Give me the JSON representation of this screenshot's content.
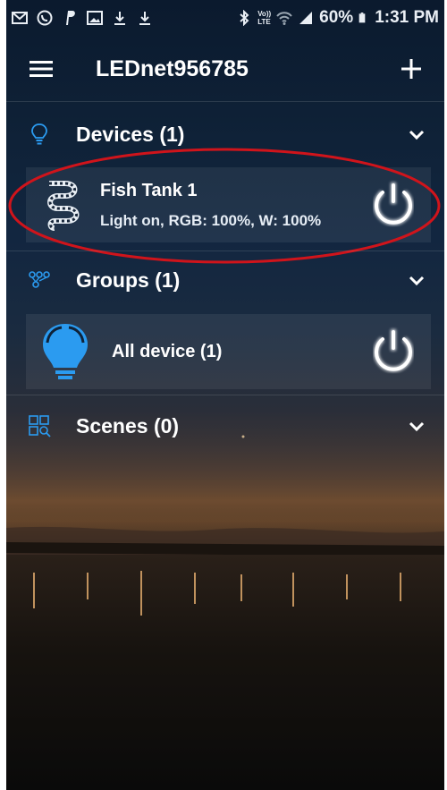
{
  "status_bar": {
    "battery": "60%",
    "time": "1:31 PM",
    "left_icons": [
      "mail-icon",
      "whatsapp-icon",
      "paypal-icon",
      "gallery-icon",
      "download-icon",
      "download-icon"
    ],
    "right_icons": [
      "bluetooth-icon",
      "volte-icon",
      "wifi-icon",
      "signal-icon",
      "battery-icon"
    ],
    "network_badge_top": "Vo))",
    "network_badge_bottom": "LTE"
  },
  "toolbar": {
    "title": "LEDnet956785",
    "menu_icon": "hamburger-menu-icon",
    "add_icon": "plus-icon"
  },
  "sections": {
    "devices": {
      "title": "Devices (1)",
      "icon": "lightbulb-outline-icon",
      "items": [
        {
          "name": "Fish Tank 1",
          "status": "Light on, RGB: 100%, W: 100%",
          "icon": "led-strip-icon"
        }
      ]
    },
    "groups": {
      "title": "Groups (1)",
      "icon": "group-nodes-icon",
      "items": [
        {
          "name": "All device (1)",
          "icon": "lightbulb-filled-icon"
        }
      ]
    },
    "scenes": {
      "title": "Scenes (0)",
      "icon": "scenes-grid-icon"
    }
  },
  "colors": {
    "accent_blue": "#2b9bf0",
    "highlight_red": "#d0141b",
    "text_white": "#ffffff"
  }
}
